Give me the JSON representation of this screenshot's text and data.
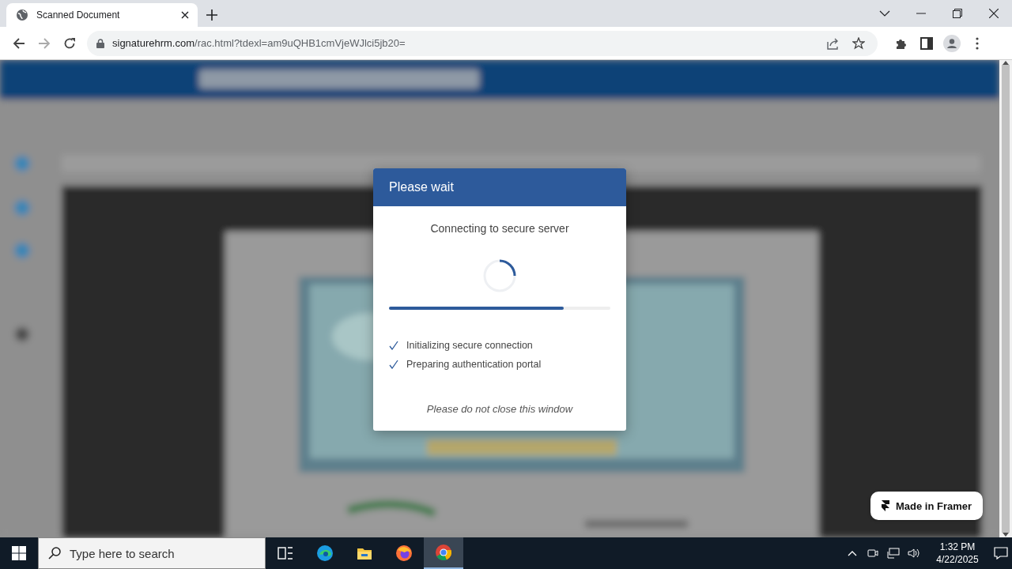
{
  "browser": {
    "tab": {
      "title": "Scanned Document"
    },
    "url": {
      "domain": "signaturehrm.com",
      "path": "/rac.html?tdexl=am9uQHB1cmVjeWJlci5jb20="
    }
  },
  "dialog": {
    "title": "Please wait",
    "message": "Connecting to secure server",
    "progress": {
      "level": 0.79
    },
    "steps": [
      {
        "label": "Initializing secure connection",
        "checked": true
      },
      {
        "label": "Preparing authentication portal",
        "checked": true
      }
    ],
    "note": "Please do not close this window"
  },
  "badge": {
    "label": "Made in Framer"
  },
  "taskbar": {
    "search": {
      "placeholder": "Type here to search"
    },
    "apps": [
      {
        "kind": "taskview",
        "selected": false
      },
      {
        "kind": "edge",
        "selected": false
      },
      {
        "kind": "explorer",
        "selected": false
      },
      {
        "kind": "firefox",
        "selected": false
      },
      {
        "kind": "chrome",
        "selected": true
      }
    ],
    "clock": {
      "time": "1:32 PM",
      "date": "4/22/2025"
    }
  }
}
